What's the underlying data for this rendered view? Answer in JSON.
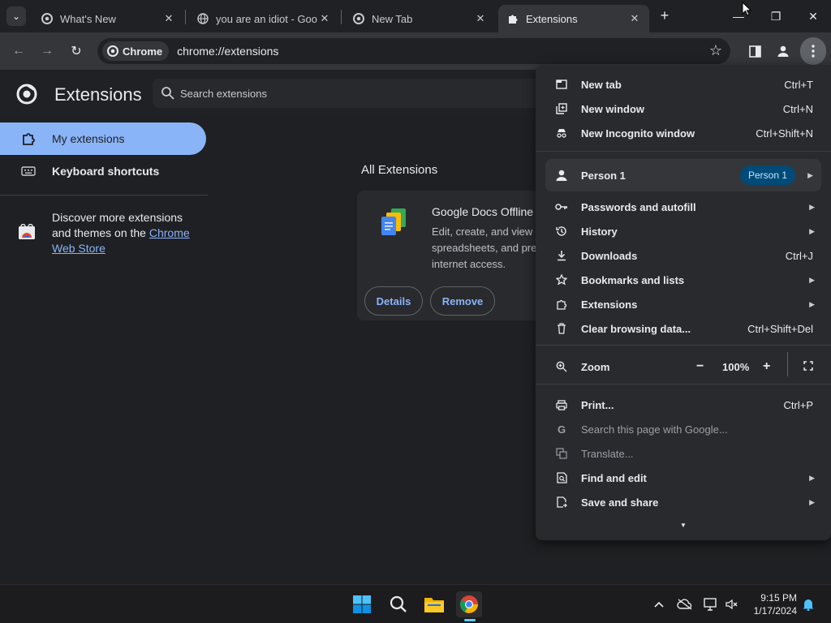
{
  "tabs": [
    {
      "title": "What's New",
      "close": "✕"
    },
    {
      "title": "you are an idiot - Goo",
      "close": "✕"
    },
    {
      "title": "New Tab",
      "close": "✕"
    },
    {
      "title": "Extensions",
      "close": "✕"
    }
  ],
  "tab_strip": {
    "new_tab": "+",
    "minimize": "—",
    "maximize": "❐",
    "close": "✕"
  },
  "toolbar": {
    "back": "←",
    "forward": "→",
    "reload": "↻",
    "chip_label": "Chrome",
    "url": "chrome://extensions",
    "bookmark_star": "☆"
  },
  "page": {
    "title": "Extensions",
    "search_placeholder": "Search extensions",
    "sidebar": [
      {
        "label": "My extensions",
        "active": true
      },
      {
        "label": "Keyboard shortcuts",
        "active": false
      }
    ],
    "discover_text": "Discover more extensions and themes on the ",
    "discover_link": "Chrome Web Store",
    "section_heading": "All Extensions",
    "extension": {
      "name": "Google Docs Offline",
      "description_lines": [
        "Edit, create, and view y",
        "spreadsheets, and pres",
        "internet access."
      ],
      "details_label": "Details",
      "remove_label": "Remove"
    }
  },
  "menu": {
    "items_top": [
      {
        "label": "New tab",
        "shortcut": "Ctrl+T",
        "icon": "new-tab-icon"
      },
      {
        "label": "New window",
        "shortcut": "Ctrl+N",
        "icon": "new-window-icon"
      },
      {
        "label": "New Incognito window",
        "shortcut": "Ctrl+Shift+N",
        "icon": "incognito-icon"
      }
    ],
    "person": {
      "label": "Person 1",
      "badge": "Person 1"
    },
    "items_mid": [
      {
        "label": "Passwords and autofill",
        "shortcut": "",
        "submenu": true,
        "icon": "key-icon"
      },
      {
        "label": "History",
        "shortcut": "",
        "submenu": true,
        "icon": "history-icon"
      },
      {
        "label": "Downloads",
        "shortcut": "Ctrl+J",
        "submenu": false,
        "icon": "download-icon"
      },
      {
        "label": "Bookmarks and lists",
        "shortcut": "",
        "submenu": true,
        "icon": "star-icon"
      },
      {
        "label": "Extensions",
        "shortcut": "",
        "submenu": true,
        "icon": "puzzle-icon"
      },
      {
        "label": "Clear browsing data...",
        "shortcut": "Ctrl+Shift+Del",
        "submenu": false,
        "icon": "trash-icon"
      }
    ],
    "zoom": {
      "label": "Zoom",
      "minus": "−",
      "value": "100%",
      "plus": "+",
      "fullscreen": "⛶"
    },
    "items_bottom": [
      {
        "label": "Print...",
        "shortcut": "Ctrl+P",
        "submenu": false,
        "dim": false,
        "icon": "print-icon"
      },
      {
        "label": "Search this page with Google...",
        "shortcut": "",
        "submenu": false,
        "dim": true,
        "icon": "google-g-icon"
      },
      {
        "label": "Translate...",
        "shortcut": "",
        "submenu": false,
        "dim": true,
        "icon": "translate-icon"
      },
      {
        "label": "Find and edit",
        "shortcut": "",
        "submenu": true,
        "dim": false,
        "icon": "find-icon"
      },
      {
        "label": "Save and share",
        "shortcut": "",
        "submenu": true,
        "dim": false,
        "icon": "save-share-icon"
      }
    ],
    "more_caret": "▼"
  },
  "taskbar": {
    "time": "9:15 PM",
    "date": "1/17/2024"
  },
  "colors": {
    "accent": "#8ab4f8",
    "menu_bg": "#292a2d",
    "badge_bg": "#004a77"
  }
}
